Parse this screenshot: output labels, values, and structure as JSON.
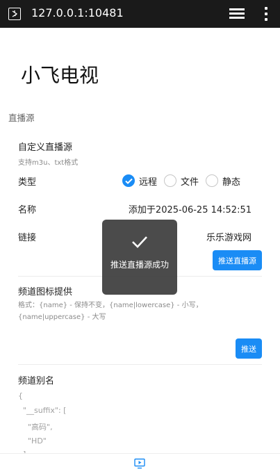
{
  "browser": {
    "url": "127.0.0.1:10481",
    "site_icon": "site-info-icon",
    "tabs_icon": "tabs-icon",
    "menu_icon": "menu-dots-icon"
  },
  "app": {
    "title": "小飞电视",
    "accent_color": "#1a8cf5"
  },
  "section": {
    "label": "直播源"
  },
  "custom_source": {
    "title": "自定义直播源",
    "subtitle": "支持m3u、txt格式",
    "type_label": "类型",
    "type_options": [
      "远程",
      "文件",
      "静态"
    ],
    "type_selected": "远程",
    "name_label": "名称",
    "name_value": "添加于2025-06-25 14:52:51",
    "link_label": "链接",
    "link_value": "乐乐游戏网",
    "push_button": "推送直播源"
  },
  "icon_provider": {
    "title": "频道图标提供",
    "hint": "格式：{name} - 保持不变，{name|lowercase} - 小写，{name|uppercase} - 大写",
    "push_button": "推送"
  },
  "alias": {
    "title": "频道别名",
    "code_lines": [
      "{",
      "  \"__suffix\": [",
      "    \"高码\",",
      "    \"HD\"",
      "  ]"
    ]
  },
  "toast": {
    "message": "推送直播源成功",
    "icon": "checkmark-icon"
  },
  "bottom_nav": {
    "icon": "tv-icon"
  }
}
